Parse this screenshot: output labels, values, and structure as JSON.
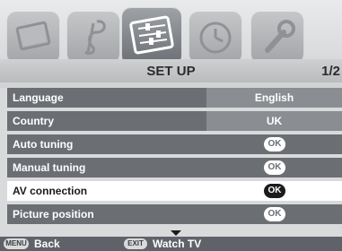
{
  "header": {
    "title": "SET UP",
    "page": "1/2"
  },
  "icons": [
    {
      "name": "tv-picture-icon"
    },
    {
      "name": "music-note-icon"
    },
    {
      "name": "setup-sliders-icon",
      "active": true
    },
    {
      "name": "clock-icon"
    },
    {
      "name": "wrench-icon"
    }
  ],
  "rows": [
    {
      "label": "Language",
      "value": "English",
      "type": "value"
    },
    {
      "label": "Country",
      "value": "UK",
      "type": "value"
    },
    {
      "label": "Auto tuning",
      "value": "OK",
      "type": "ok"
    },
    {
      "label": "Manual tuning",
      "value": "OK",
      "type": "ok"
    },
    {
      "label": "AV connection",
      "value": "OK",
      "type": "ok",
      "selected": true
    },
    {
      "label": "Picture position",
      "value": "OK",
      "type": "ok"
    }
  ],
  "footer": {
    "menu_key": "MENU",
    "menu_label": "Back",
    "exit_key": "EXIT",
    "exit_label": "Watch TV"
  },
  "colors": {
    "row": "#6b6f74",
    "selected_row": "#ffffff",
    "footer": "#5f6369"
  }
}
